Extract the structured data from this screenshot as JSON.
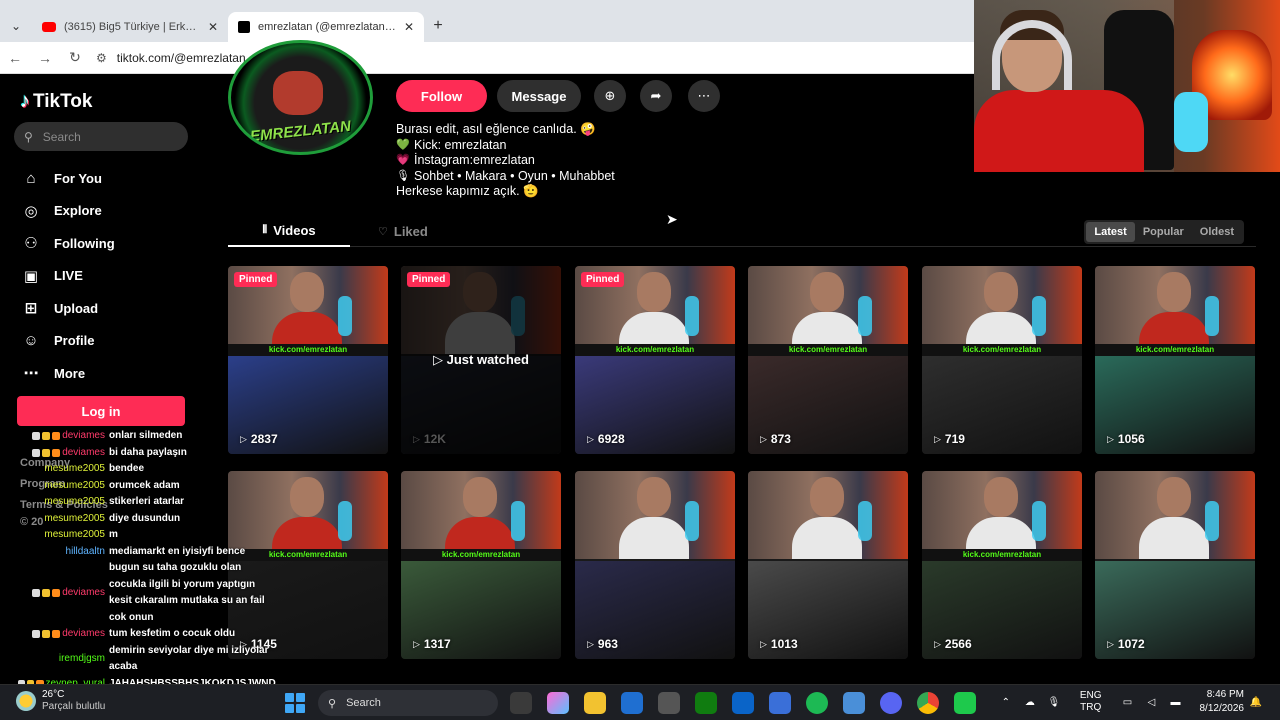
{
  "browser": {
    "tabs": [
      {
        "title": "(3615) Big5 Türkiye | Erkek Haz",
        "favicon": "youtube-icon",
        "active": false
      },
      {
        "title": "emrezlatan (@emrezlatan) | Tik",
        "favicon": "tiktok-icon",
        "active": true
      }
    ],
    "url": "tiktok.com/@emrezlatan"
  },
  "sidebar": {
    "logo": "TikTok",
    "search_placeholder": "Search",
    "items": [
      {
        "label": "For You",
        "icon": "home-icon"
      },
      {
        "label": "Explore",
        "icon": "compass-icon"
      },
      {
        "label": "Following",
        "icon": "following-icon"
      },
      {
        "label": "LIVE",
        "icon": "live-icon"
      },
      {
        "label": "Upload",
        "icon": "upload-icon"
      },
      {
        "label": "Profile",
        "icon": "profile-icon"
      },
      {
        "label": "More",
        "icon": "more-icon"
      }
    ],
    "login_label": "Log in",
    "footer": [
      "Company",
      "Program",
      "Terms & Policies",
      "© 20"
    ]
  },
  "profile": {
    "avatar_text": "EMREZLATAN",
    "follow_label": "Follow",
    "message_label": "Message",
    "bio": [
      {
        "icon": "",
        "text": "Burası edit, asıl eğlence canlıda. 🤪"
      },
      {
        "icon": "💚",
        "text": "Kick: emrezlatan"
      },
      {
        "icon": "💗",
        "text": "İnstagram:emrezlatan"
      },
      {
        "icon": "🎙",
        "text": "Sohbet • Makara • Oyun • Muhabbet"
      },
      {
        "icon": "",
        "text": "Herkese kapımız açık. 🫡"
      }
    ],
    "tabs": {
      "videos": "Videos",
      "liked": "Liked"
    },
    "sort": [
      "Latest",
      "Popular",
      "Oldest"
    ],
    "sort_active": "Latest"
  },
  "videos": [
    {
      "views": "2837",
      "pinned": "Pinned",
      "kick": "kick.com/emrezlatan",
      "shirt": "#c0281e",
      "bottom": "#2b3f8a"
    },
    {
      "views": "12K",
      "pinned": "Pinned",
      "kick": "",
      "shirt": "#dddddd",
      "bottom": "#2a3040",
      "just_watched": "Just watched"
    },
    {
      "views": "6928",
      "pinned": "Pinned",
      "kick": "kick.com/emrezlatan",
      "shirt": "#e8e8e8",
      "bottom": "#3a3a7a"
    },
    {
      "views": "873",
      "pinned": "",
      "kick": "kick.com/emrezlatan",
      "shirt": "#e8e8e8",
      "bottom": "#3a2a2a"
    },
    {
      "views": "719",
      "pinned": "",
      "kick": "kick.com/emrezlatan",
      "shirt": "#e8e8e8",
      "bottom": "#2e2e2e"
    },
    {
      "views": "1056",
      "pinned": "",
      "kick": "kick.com/emrezlatan",
      "shirt": "#c0281e",
      "bottom": "#2a6a5a"
    },
    {
      "views": "1145",
      "pinned": "",
      "kick": "kick.com/emrezlatan",
      "shirt": "#c0281e",
      "bottom": "#1a1a1a"
    },
    {
      "views": "1317",
      "pinned": "",
      "kick": "kick.com/emrezlatan",
      "shirt": "#c0281e",
      "bottom": "#3a5a3a"
    },
    {
      "views": "963",
      "pinned": "",
      "kick": "",
      "shirt": "#e8e8e8",
      "bottom": "#2a2a4a"
    },
    {
      "views": "1013",
      "pinned": "",
      "kick": "",
      "shirt": "#e8e8e8",
      "bottom": "#4a4a4a"
    },
    {
      "views": "2566",
      "pinned": "",
      "kick": "kick.com/emrezlatan",
      "shirt": "#e8e8e8",
      "bottom": "#2a3a2a"
    },
    {
      "views": "1072",
      "pinned": "",
      "kick": "",
      "shirt": "#e8e8e8",
      "bottom": "#3a6a5a"
    }
  ],
  "chat": [
    {
      "user": "deviames",
      "color": "#ff3b6b",
      "badges": true,
      "msg": "onları silmeden"
    },
    {
      "user": "deviames",
      "color": "#ff3b6b",
      "badges": true,
      "msg": "bi daha paylaşın"
    },
    {
      "user": "mesume2005",
      "color": "#e0f23a",
      "badges": false,
      "msg": "bendee"
    },
    {
      "user": "mesume2005",
      "color": "#e0f23a",
      "badges": false,
      "msg": "orumcek adam"
    },
    {
      "user": "mesume2005",
      "color": "#e0f23a",
      "badges": false,
      "msg": "stikerleri atarlar"
    },
    {
      "user": "mesume2005",
      "color": "#e0f23a",
      "badges": false,
      "msg": "diye dusundun"
    },
    {
      "user": "mesume2005",
      "color": "#e0f23a",
      "badges": false,
      "msg": "m"
    },
    {
      "user": "hilldaaltn",
      "color": "#5fb4ff",
      "badges": false,
      "msg": "mediamarkt en iyisiyfi bence"
    },
    {
      "user": "deviames",
      "color": "#ff3b6b",
      "badges": true,
      "msg": "bugun su taha gozuklu olan\ncocukla ilgili bi yorum yaptıgın\nkesit cıkaralım mutlaka su an fail\ncok onun"
    },
    {
      "user": "deviames",
      "color": "#ff3b6b",
      "badges": true,
      "msg": "tum kesfetim o cocuk oldu"
    },
    {
      "user": "iremdjgsm",
      "color": "#53fc18",
      "badges": false,
      "msg": "demirin seviyolar diye mi izliyolar\nacaba"
    },
    {
      "user": "zeynep_vural",
      "color": "#53fc18",
      "badges": true,
      "msg": "JAHAHSHBSSBHSJKQKDJSJWND"
    }
  ],
  "taskbar": {
    "weather_temp": "26°C",
    "weather_desc": "Parçalı bulutlu",
    "search_label": "Search",
    "lang_top": "ENG",
    "lang_bottom": "TRQ",
    "time": "8:46 PM",
    "date": "8/12/2026"
  }
}
